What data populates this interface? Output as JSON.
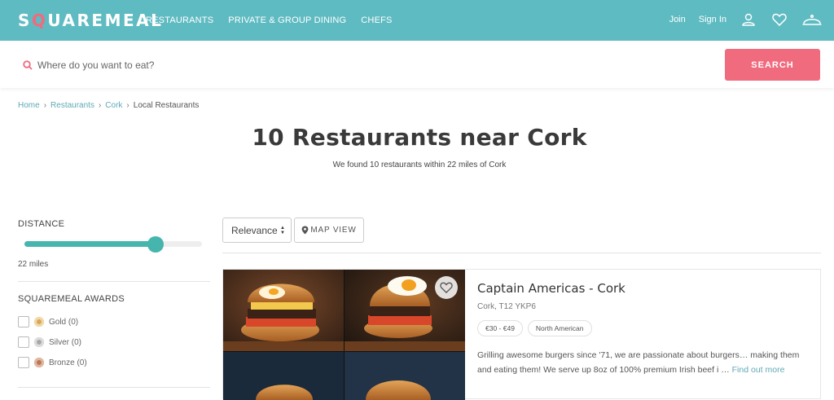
{
  "nav": {
    "logo_pre": "S",
    "logo_q": "Q",
    "logo_post": "UAREMEAL",
    "links": [
      "RESTAURANTS",
      "PRIVATE & GROUP DINING",
      "CHEFS"
    ],
    "join": "Join",
    "sign_in": "Sign In",
    "icons": [
      "user-icon",
      "heart-icon",
      "cloche-icon"
    ]
  },
  "search": {
    "placeholder": "Where do you want to eat?",
    "button": "SEARCH"
  },
  "breadcrumb": {
    "items": [
      "Home",
      "Restaurants",
      "Cork"
    ],
    "current": "Local Restaurants"
  },
  "header": {
    "title": "10 Restaurants near Cork",
    "subtitle": "We found 10 restaurants within 22 miles of Cork"
  },
  "sidebar": {
    "distance_heading": "DISTANCE",
    "distance_value": "22 miles",
    "distance_fraction": 0.74,
    "awards_heading": "SQUAREMEAL AWARDS",
    "awards": [
      {
        "label": "Gold (0)",
        "color": "#d6a75c"
      },
      {
        "label": "Silver (0)",
        "color": "#a8a8a8"
      },
      {
        "label": "Bronze (0)",
        "color": "#b8795a"
      }
    ]
  },
  "toolbar": {
    "sort_value": "Relevance",
    "map_view": "MAP VIEW"
  },
  "results": [
    {
      "name": "Captain Americas - Cork",
      "location": "Cork, T12 YKP6",
      "tags": [
        "€30 - €49",
        "North American"
      ],
      "description": "Grilling awesome burgers since '71, we are passionate about burgers… making them and eating them! We serve up 8oz of 100% premium Irish beef i …",
      "link": "Find out more"
    }
  ],
  "colors": {
    "nav_bg": "#5fbbc2",
    "accent_pink": "#f06b7e",
    "slider_teal": "#45b5ad",
    "link_blue": "#5fa9b5"
  }
}
